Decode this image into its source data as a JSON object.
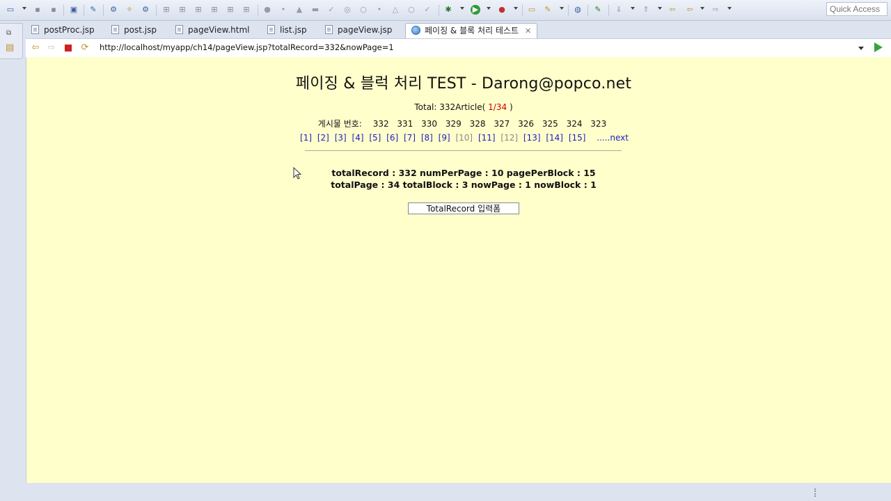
{
  "toolbar": {
    "quick_access_placeholder": "Quick Access",
    "icons": [
      "new-icon",
      "save-icon",
      "save-all-icon",
      "print-icon",
      "search-icon",
      "open-type-icon",
      "run-server-icon",
      "debug-icon",
      "run-icon",
      "external-tools-icon",
      "back-icon",
      "forward-icon"
    ]
  },
  "tabs": [
    {
      "label": "postProc.jsp",
      "active": false
    },
    {
      "label": "post.jsp",
      "active": false
    },
    {
      "label": "pageView.html",
      "active": false
    },
    {
      "label": "list.jsp",
      "active": false
    },
    {
      "label": "pageView.jsp",
      "active": false
    },
    {
      "label": "페이징 & 블록 처리 테스트",
      "active": true
    }
  ],
  "browser": {
    "url": "http://localhost/myapp/ch14/pageView.jsp?totalRecord=332&nowPage=1"
  },
  "page": {
    "title": "페이징 & 블럭 처리 TEST - Darong@popco.net",
    "total_prefix": "Total: 332Article(",
    "total_page_info": "1/34",
    "total_suffix": ")",
    "article_label": "게시물 번호:",
    "article_numbers": [
      "332",
      "331",
      "330",
      "329",
      "328",
      "327",
      "326",
      "325",
      "324",
      "323"
    ],
    "page_links": [
      "[1]",
      "[2]",
      "[3]",
      "[4]",
      "[5]",
      "[6]",
      "[7]",
      "[8]",
      "[9]",
      "[10]",
      "[11]",
      "[12]",
      "[13]",
      "[14]",
      "[15]"
    ],
    "next_link": ".....next",
    "stats_line1": "totalRecord : 332  numPerPage : 10  pagePerBlock : 15",
    "stats_line2": "totalPage : 34  totalBlock : 3  nowPage : 1  nowBlock : 1",
    "form_button": "TotalRecord 입력폼"
  },
  "colors": {
    "content_bg": "#ffffcc",
    "link": "#2020c0",
    "highlight": "#cc0000",
    "chrome_bg": "#dde4f0"
  }
}
